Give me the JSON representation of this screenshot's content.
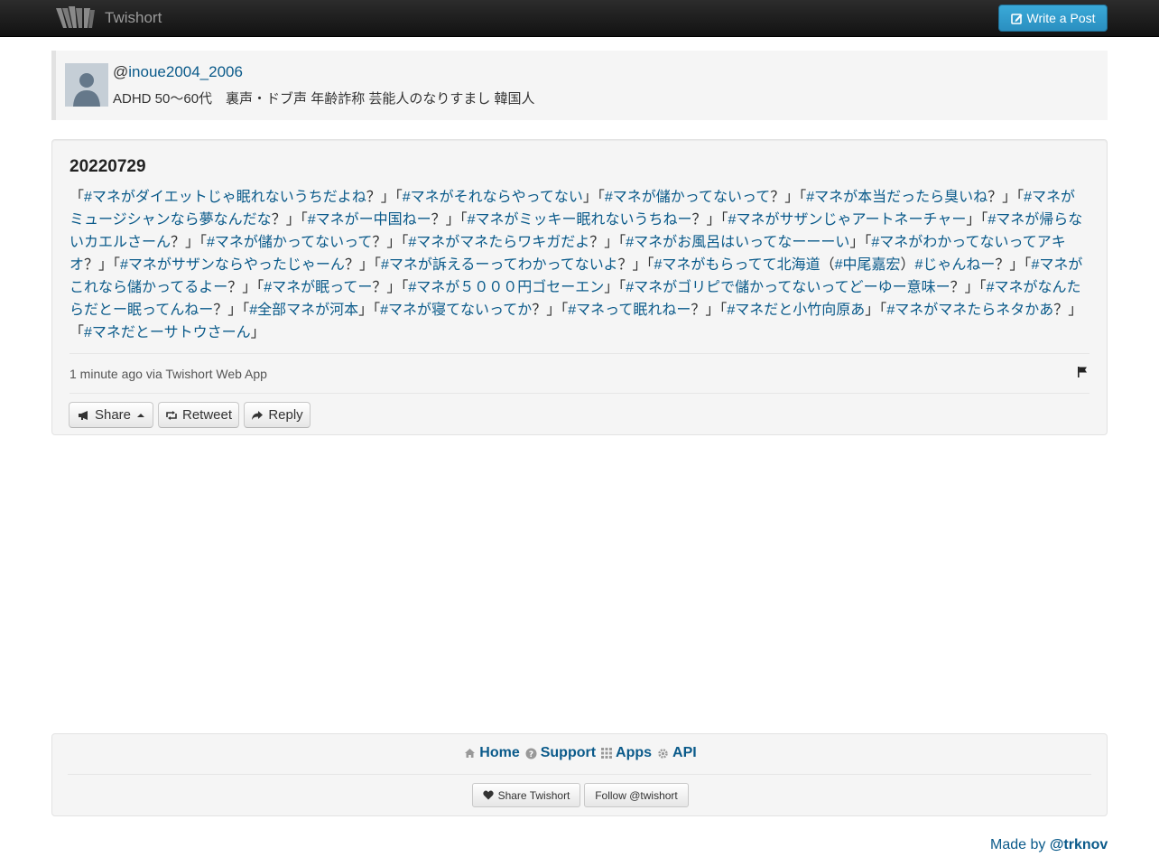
{
  "navbar": {
    "brand": "Twishort",
    "write_button": "Write a Post",
    "accent": "#2a9fd6"
  },
  "profile": {
    "at": "@",
    "username": "inoue2004_2006",
    "bio": "ADHD 50～60代　裏声・ドブ声 年齢詐称 芸能人のなりすまし 韓国人"
  },
  "post": {
    "title": "20220729",
    "segments": [
      {
        "t": "「"
      },
      {
        "t": "#マネがダイエットじゃ眠れないうちだよね",
        "h": true
      },
      {
        "t": "？」「"
      },
      {
        "t": "#マネがそれならやってない",
        "h": true
      },
      {
        "t": "」「"
      },
      {
        "t": "#マネが儲かってないって",
        "h": true
      },
      {
        "t": "？」「"
      },
      {
        "t": "#マネが本当だったら臭いね",
        "h": true
      },
      {
        "t": "？」「"
      },
      {
        "t": "#マネがミュージシャンなら夢なんだな",
        "h": true
      },
      {
        "t": "？」「"
      },
      {
        "t": "#マネがー中国ねー",
        "h": true
      },
      {
        "t": "？」「"
      },
      {
        "t": "#マネがミッキー眠れないうちねー",
        "h": true
      },
      {
        "t": "？」「"
      },
      {
        "t": "#マネがサザンじゃアートネーチャー",
        "h": true
      },
      {
        "t": "」「"
      },
      {
        "t": "#マネが帰らないカエルさーん",
        "h": true
      },
      {
        "t": "？」「"
      },
      {
        "t": "#マネが儲かってないって",
        "h": true
      },
      {
        "t": "？」「"
      },
      {
        "t": "#マネがマネたらワキガだよ",
        "h": true
      },
      {
        "t": "？」「"
      },
      {
        "t": "#マネがお風呂はいってなーーーい",
        "h": true
      },
      {
        "t": "」「"
      },
      {
        "t": "#マネがわかってないってアキオ",
        "h": true
      },
      {
        "t": "？」「"
      },
      {
        "t": "#マネがサザンならやったじゃーん",
        "h": true
      },
      {
        "t": "？」「"
      },
      {
        "t": "#マネが訴えるーってわかってないよ",
        "h": true
      },
      {
        "t": "？」「"
      },
      {
        "t": "#マネがもらってて北海道",
        "h": true
      },
      {
        "t": "（"
      },
      {
        "t": "#中尾嘉宏",
        "h": true
      },
      {
        "t": "）"
      },
      {
        "t": "#じゃんねー",
        "h": true
      },
      {
        "t": "？」「"
      },
      {
        "t": "#マネがこれなら儲かってるよー",
        "h": true
      },
      {
        "t": "？」「"
      },
      {
        "t": "#マネが眠ってー",
        "h": true
      },
      {
        "t": "？」「"
      },
      {
        "t": "#マネが５０００円ゴセーエン",
        "h": true
      },
      {
        "t": "」「"
      },
      {
        "t": "#マネがゴリピで儲かってないってどーゆー意味ー",
        "h": true
      },
      {
        "t": "？」「"
      },
      {
        "t": "#マネがなんたらだとー眠ってんねー",
        "h": true
      },
      {
        "t": "？」「"
      },
      {
        "t": "#全部マネが河本",
        "h": true
      },
      {
        "t": "」「"
      },
      {
        "t": "#マネが寝てないってか",
        "h": true
      },
      {
        "t": "？」「"
      },
      {
        "t": "#マネって眠れねー",
        "h": true
      },
      {
        "t": "？」「"
      },
      {
        "t": "#マネだと小竹向原あ",
        "h": true
      },
      {
        "t": "」「"
      },
      {
        "t": "#マネがマネたらネタかあ",
        "h": true
      },
      {
        "t": "？」「"
      },
      {
        "t": "#マネだとーサトウさーん",
        "h": true
      },
      {
        "t": "」"
      }
    ],
    "meta": "1 minute ago via Twishort Web App",
    "buttons": {
      "share": "Share",
      "retweet": "Retweet",
      "reply": "Reply"
    }
  },
  "footer": {
    "links": {
      "home": "Home",
      "support": "Support",
      "apps": "Apps",
      "api": "API"
    },
    "share_twishort": "Share Twishort",
    "follow": "Follow @twishort"
  },
  "made_by": {
    "prefix": "Made by ",
    "handle": "@trknov"
  },
  "colors": {
    "link": "#0a5a8a",
    "well": "#f5f5f5"
  }
}
